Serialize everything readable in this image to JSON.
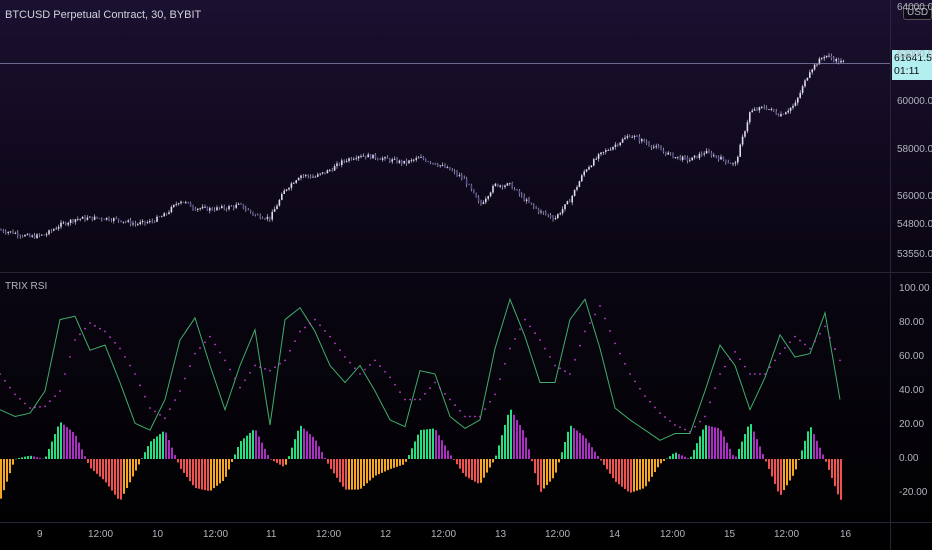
{
  "header": {
    "title": "BTCUSD Perpetual Contract, 30, BYBIT",
    "currency": "USD",
    "last_price": "61641.5",
    "countdown": "01:11"
  },
  "indicator": {
    "title": "TRIX RSI"
  },
  "colors": {
    "candle": "#e0dcf0",
    "rsi": "#3fae6a",
    "signal": "#c040d0",
    "hist_pos_up": "#26e07f",
    "hist_pos_down": "#a82fc0",
    "hist_neg_down": "#f0524f",
    "hist_neg_up": "#f5a623"
  },
  "chart_data": [
    {
      "type": "candlestick",
      "title": "BTCUSD Perpetual Contract, 30, BYBIT",
      "y_ticks": [
        "64000.0",
        "62000.0",
        "60000.0",
        "58000.0",
        "56000.0",
        "54800.0",
        "53550.0"
      ],
      "ylim": [
        53000,
        64500
      ],
      "close_sampled": [
        54610,
        54480,
        54310,
        54400,
        54820,
        55070,
        55110,
        55110,
        55030,
        54860,
        54940,
        55240,
        55870,
        55540,
        55490,
        55540,
        55660,
        55240,
        55110,
        56300,
        56930,
        56850,
        57140,
        57560,
        57780,
        57690,
        57560,
        57440,
        57650,
        57440,
        57140,
        56720,
        55660,
        56510,
        56510,
        55870,
        55370,
        55110,
        55870,
        57140,
        57780,
        58200,
        58620,
        58320,
        57990,
        57690,
        57560,
        57900,
        57650,
        57350,
        59590,
        59800,
        59470,
        59890,
        61370,
        62000,
        61700
      ]
    },
    {
      "type": "line+bar",
      "title": "TRIX RSI",
      "y_ticks": [
        "100.00",
        "80.00",
        "60.00",
        "40.00",
        "20.00",
        "0.00",
        "-20.00"
      ],
      "ylim": [
        -30,
        105
      ],
      "series": [
        {
          "name": "TRIX RSI",
          "values": [
            29,
            25,
            27,
            40,
            82,
            84,
            64,
            67,
            45,
            21,
            17,
            35,
            70,
            83,
            55,
            29,
            55,
            76,
            20,
            82,
            89,
            75,
            55,
            45,
            55,
            40,
            23,
            19,
            52,
            50,
            25,
            18,
            23,
            65,
            94,
            72,
            45,
            45,
            82,
            94,
            65,
            30,
            23,
            17,
            11,
            15,
            15,
            40,
            67,
            55,
            29,
            48,
            73,
            60,
            62,
            86,
            35
          ]
        },
        {
          "name": "Signal",
          "values": [
            50,
            38,
            30,
            31,
            40,
            70,
            80,
            75,
            65,
            50,
            30,
            24,
            40,
            62,
            72,
            58,
            42,
            55,
            52,
            58,
            75,
            82,
            72,
            60,
            50,
            58,
            48,
            35,
            35,
            45,
            35,
            25,
            25,
            38,
            65,
            82,
            70,
            55,
            50,
            75,
            90,
            68,
            50,
            37,
            27,
            20,
            16,
            25,
            50,
            63,
            50,
            50,
            62,
            72,
            65,
            78,
            58
          ]
        },
        {
          "name": "Histogram",
          "values": [
            -25,
            0,
            2,
            0,
            22,
            15,
            -5,
            -13,
            -25,
            -8,
            10,
            17,
            -5,
            -17,
            -19,
            -12,
            10,
            18,
            0,
            -5,
            20,
            12,
            -5,
            -18,
            -18,
            -10,
            -6,
            -3,
            17,
            18,
            3,
            -10,
            -15,
            0,
            30,
            15,
            -20,
            -10,
            20,
            13,
            0,
            -13,
            -20,
            -17,
            -3,
            4,
            0,
            20,
            18,
            0,
            22,
            0,
            -22,
            -8,
            20,
            0,
            -24
          ]
        }
      ]
    },
    {
      "type": "time_axis",
      "x_ticks": [
        "9",
        "12:00",
        "10",
        "12:00",
        "11",
        "12:00",
        "12",
        "12:00",
        "13",
        "12:00",
        "14",
        "12:00",
        "15",
        "12:00",
        "16"
      ]
    }
  ]
}
